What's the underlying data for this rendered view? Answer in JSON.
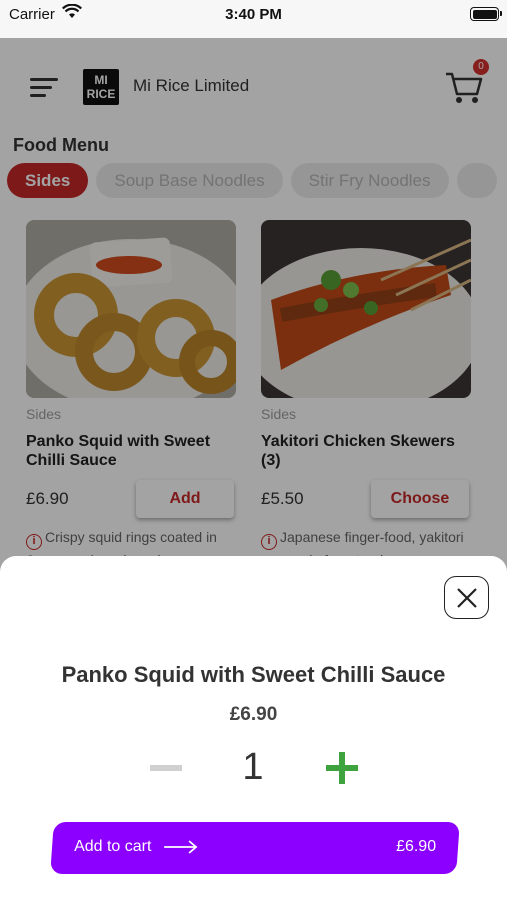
{
  "status_bar": {
    "carrier": "Carrier",
    "time": "3:40 PM"
  },
  "header": {
    "brand_name": "Mi Rice Limited",
    "logo_text": "MI RICE",
    "cart_count": "0"
  },
  "menu": {
    "title": "Food Menu",
    "tabs": [
      {
        "label": "Sides",
        "active": true
      },
      {
        "label": "Soup Base Noodles",
        "active": false
      },
      {
        "label": "Stir Fry Noodles",
        "active": false
      },
      {
        "label": "",
        "active": false
      }
    ]
  },
  "products": [
    {
      "category": "Sides",
      "name": "Panko Squid with Sweet Chilli Sauce",
      "price": "£6.90",
      "action": "Add",
      "description": "Crispy squid rings coated in Japanese breadcrumbs"
    },
    {
      "category": "Sides",
      "name": "Yakitori Chicken Skewers (3)",
      "price": "£5.50",
      "action": "Choose",
      "description": "Japanese finger-food, yakitori are made from tender"
    }
  ],
  "sheet": {
    "title": "Panko Squid with Sweet Chilli Sauce",
    "price": "£6.90",
    "quantity": "1",
    "add_to_cart_label": "Add to cart",
    "total": "£6.90"
  },
  "colors": {
    "accent_red": "#c62828",
    "cart_button": "#8b00ff",
    "plus_green": "#3ea23e"
  }
}
